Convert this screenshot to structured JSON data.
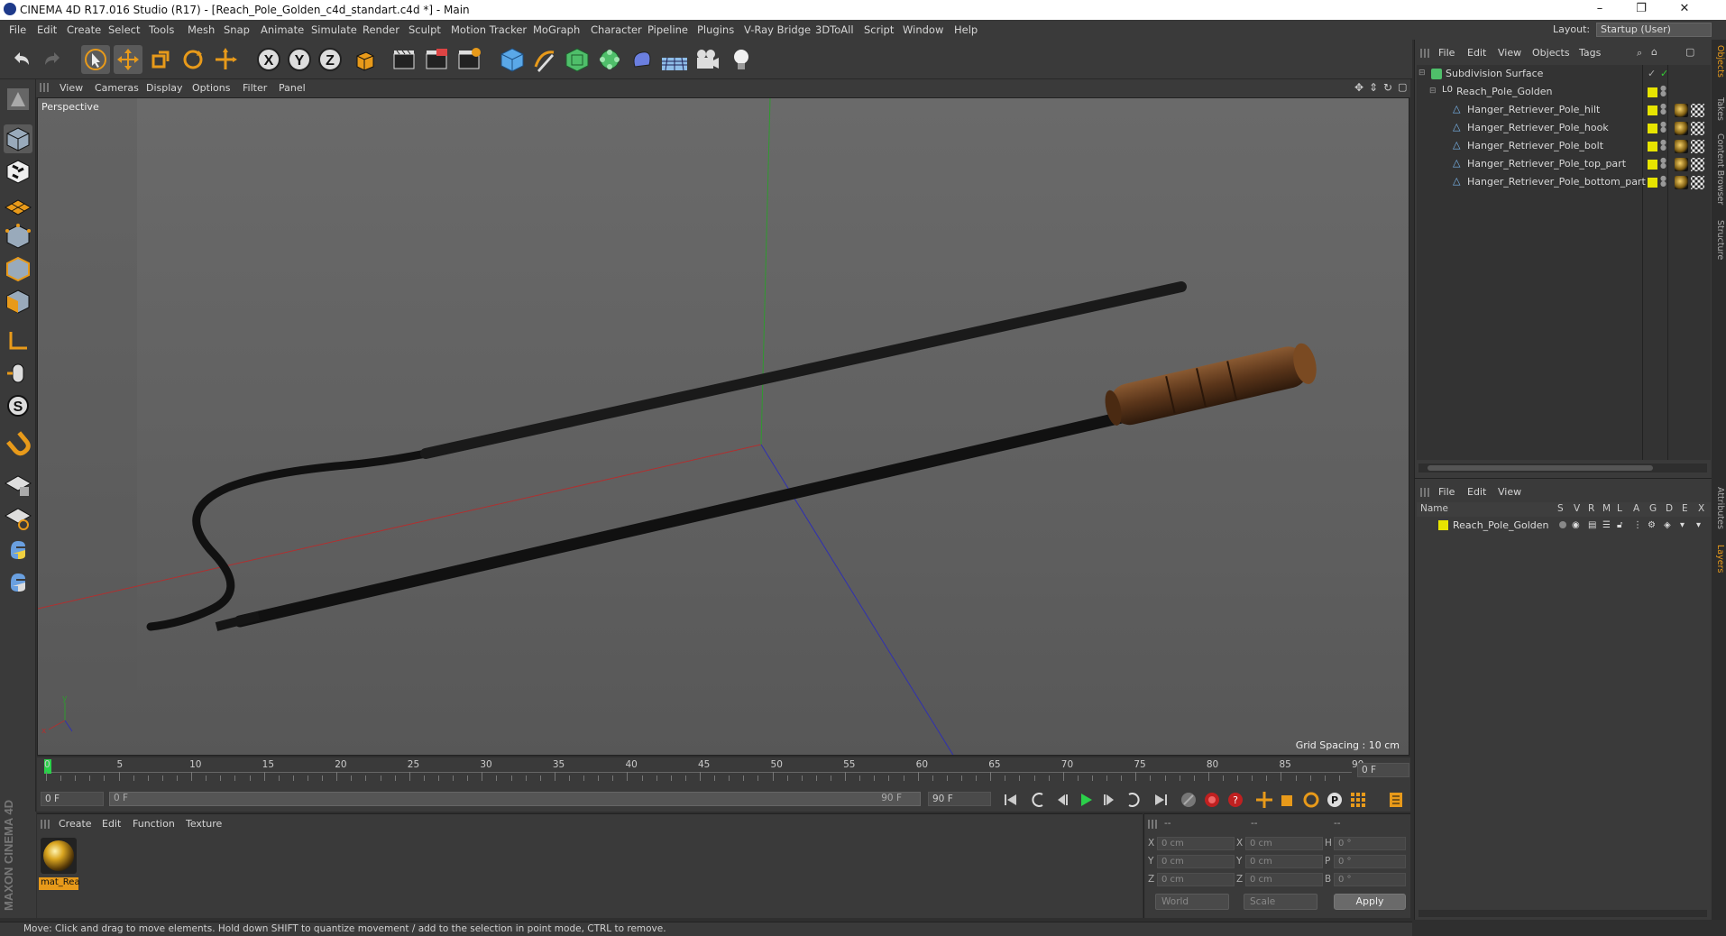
{
  "window": {
    "title": "CINEMA 4D R17.016 Studio (R17) - [Reach_Pole_Golden_c4d_standart.c4d *] - Main",
    "controls": [
      "–",
      "❐",
      "✕"
    ]
  },
  "menu": [
    "File",
    "Edit",
    "Create",
    "Select",
    "Tools",
    "Mesh",
    "Snap",
    "Animate",
    "Simulate",
    "Render",
    "Sculpt",
    "Motion Tracker",
    "MoGraph",
    "Character",
    "Pipeline",
    "Plugins",
    "V-Ray Bridge",
    "3DToAll",
    "Script",
    "Window",
    "Help"
  ],
  "layout": {
    "label": "Layout:",
    "value": "Startup (User)"
  },
  "toolbar_icons": [
    "undo-icon",
    "redo-icon",
    "select-arrow-icon",
    "move-icon",
    "scale-icon",
    "rotate-icon",
    "transform-icon",
    "x-axis-icon",
    "y-axis-icon",
    "z-axis-icon",
    "coordinate-system-icon",
    "render-view-icon",
    "render-region-icon",
    "render-settings-icon",
    "cube-icon",
    "pen-icon",
    "subdivision-icon",
    "mograph-cloner-icon",
    "deformer-icon",
    "floor-icon",
    "camera-icon",
    "light-icon"
  ],
  "viewport": {
    "menu": [
      "View",
      "Cameras",
      "Display",
      "Options",
      "Filter",
      "Panel"
    ],
    "camera_label": "Perspective",
    "grid_spacing": "Grid Spacing : 10 cm"
  },
  "timeline": {
    "ticks": [
      "0",
      "5",
      "10",
      "15",
      "20",
      "25",
      "30",
      "35",
      "40",
      "45",
      "50",
      "55",
      "60",
      "65",
      "70",
      "75",
      "80",
      "85",
      "90"
    ],
    "current_frame": "0 F",
    "start_field": "0 F",
    "range_start": "0 F",
    "range_end": "90 F",
    "end_field": "90 F"
  },
  "material_manager": {
    "menu": [
      "Create",
      "Edit",
      "Function",
      "Texture"
    ],
    "material_name": "mat_Rea"
  },
  "brand": "MAXON CINEMA 4D",
  "coordinates": {
    "header": [
      "--",
      "--",
      "--"
    ],
    "rows": [
      {
        "axis": "X",
        "pos": "0 cm",
        "axis2": "X",
        "size": "0 cm",
        "rot_axis": "H",
        "rot": "0 °"
      },
      {
        "axis": "Y",
        "pos": "0 cm",
        "axis2": "Y",
        "size": "0 cm",
        "rot_axis": "P",
        "rot": "0 °"
      },
      {
        "axis": "Z",
        "pos": "0 cm",
        "axis2": "Z",
        "size": "0 cm",
        "rot_axis": "B",
        "rot": "0 °"
      }
    ],
    "space_select": "World",
    "mode_select": "Scale",
    "apply_label": "Apply"
  },
  "status": "Move: Click and drag to move elements. Hold down SHIFT to quantize movement / add to the selection in point mode, CTRL to remove.",
  "object_manager": {
    "menu": [
      "File",
      "Edit",
      "View",
      "Objects",
      "Tags"
    ],
    "objects": [
      {
        "name": "Subdivision Surface",
        "level": 0,
        "icon": "subdivision-icon"
      },
      {
        "name": "Reach_Pole_Golden",
        "level": 1,
        "icon": "null-icon"
      },
      {
        "name": "Hanger_Retriever_Pole_hilt",
        "level": 2,
        "icon": "polygon-icon"
      },
      {
        "name": "Hanger_Retriever_Pole_hook",
        "level": 2,
        "icon": "polygon-icon"
      },
      {
        "name": "Hanger_Retriever_Pole_bolt",
        "level": 2,
        "icon": "polygon-icon"
      },
      {
        "name": "Hanger_Retriever_Pole_top_part",
        "level": 2,
        "icon": "polygon-icon"
      },
      {
        "name": "Hanger_Retriever_Pole_bottom_part",
        "level": 2,
        "icon": "polygon-icon"
      }
    ]
  },
  "layer_manager": {
    "menu": [
      "File",
      "Edit",
      "View"
    ],
    "columns": [
      "Name",
      "S",
      "V",
      "R",
      "M",
      "L",
      "A",
      "G",
      "D",
      "E",
      "X"
    ],
    "layers": [
      {
        "name": "Reach_Pole_Golden",
        "color": "#e7e400"
      }
    ]
  },
  "right_tabs": [
    "Objects",
    "Takes",
    "Content Browser",
    "Structure",
    "Attributes",
    "Layers"
  ],
  "colors": {
    "accent": "#e89a1a",
    "layer_yellow": "#e7e400",
    "x_axis": "#b03030",
    "y_axis": "#2f9a2f",
    "z_axis": "#3030b0"
  }
}
